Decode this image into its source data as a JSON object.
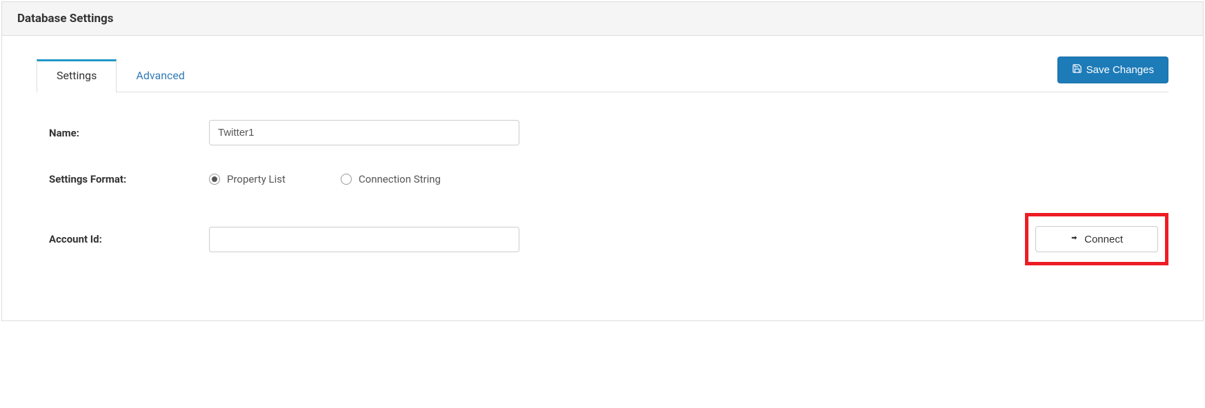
{
  "header": {
    "title": "Database Settings"
  },
  "tabs": {
    "settings": "Settings",
    "advanced": "Advanced"
  },
  "buttons": {
    "save": "Save Changes",
    "connect": "Connect"
  },
  "form": {
    "name_label": "Name:",
    "name_value": "Twitter1",
    "settings_format_label": "Settings Format:",
    "radio_property_list": "Property List",
    "radio_connection_string": "Connection String",
    "account_id_label": "Account Id:",
    "account_id_value": ""
  }
}
